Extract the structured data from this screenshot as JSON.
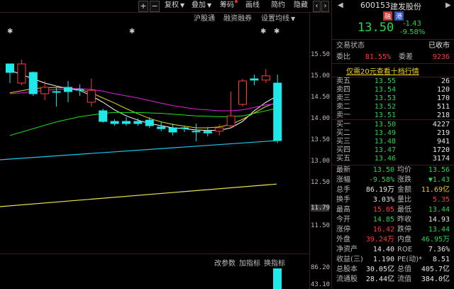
{
  "toolbar": {
    "plus": "+",
    "minus": "−",
    "restore": "复权",
    "overlay": "叠加",
    "chips": "筹码",
    "draw": "画线",
    "short": "简约",
    "hide": "隐藏",
    "prev": "‹",
    "next": "›"
  },
  "subbar": {
    "hgt": "沪股通",
    "margin": "融资融券",
    "ma_settings": "设置均线",
    "marker": "✱"
  },
  "price_axis": [
    "15.50",
    "15.00",
    "14.50",
    "14.00",
    "13.50",
    "13.00",
    "12.50",
    "11.79",
    "11.50"
  ],
  "volume_axis": [
    "86.20",
    "43.10"
  ],
  "indicator_bar": {
    "params": "改参数",
    "add": "加指标",
    "switch": "换指标"
  },
  "stock": {
    "code": "600153",
    "name": "建发股份",
    "tag1": "融",
    "tag2": "港",
    "price": "13.50",
    "change": "-1.43",
    "pct": "-9.58%"
  },
  "status": {
    "label": "交易状态",
    "value": "已收市"
  },
  "ratio": {
    "wb_label": "委比",
    "wb_value": "81.55%",
    "wc_label": "委差",
    "wc_value": "9236"
  },
  "promo": "仅需20元查看十档行情",
  "asks": [
    {
      "label": "卖五",
      "price": "13.55",
      "vol": "26"
    },
    {
      "label": "卖四",
      "price": "13.54",
      "vol": "120"
    },
    {
      "label": "卖三",
      "price": "13.53",
      "vol": "170"
    },
    {
      "label": "卖二",
      "price": "13.52",
      "vol": "511"
    },
    {
      "label": "卖一",
      "price": "13.51",
      "vol": "218"
    }
  ],
  "bids": [
    {
      "label": "买一",
      "price": "13.50",
      "vol": "4227"
    },
    {
      "label": "买二",
      "price": "13.49",
      "vol": "219"
    },
    {
      "label": "买三",
      "price": "13.48",
      "vol": "941"
    },
    {
      "label": "买四",
      "price": "13.47",
      "vol": "1720"
    },
    {
      "label": "买五",
      "price": "13.46",
      "vol": "3174"
    }
  ],
  "stats": [
    {
      "l1": "最新",
      "v1": "13.50",
      "c1": "green",
      "l2": "均价",
      "v2": "13.56",
      "c2": "green"
    },
    {
      "l1": "涨幅",
      "v1": "-9.58%",
      "c1": "green",
      "l2": "涨跌",
      "v2": "▼1.43",
      "c2": "green"
    },
    {
      "l1": "总手",
      "v1": "86.19万",
      "c1": "white",
      "l2": "金额",
      "v2": "11.69亿",
      "c2": "yellow"
    },
    {
      "l1": "换手",
      "v1": "3.03%",
      "c1": "white",
      "l2": "量比",
      "v2": "5.35",
      "c2": "red"
    },
    {
      "l1": "最高",
      "v1": "15.05",
      "c1": "red",
      "l2": "最低",
      "v2": "13.44",
      "c2": "green"
    },
    {
      "l1": "今开",
      "v1": "14.85",
      "c1": "green",
      "l2": "昨收",
      "v2": "14.93",
      "c2": "white"
    },
    {
      "l1": "涨停",
      "v1": "16.42",
      "c1": "red",
      "l2": "跌停",
      "v2": "13.44",
      "c2": "green"
    },
    {
      "l1": "外盘",
      "v1": "39.24万",
      "c1": "red",
      "l2": "内盘",
      "v2": "46.95万",
      "c2": "green"
    },
    {
      "l1": "净资产",
      "v1": "14.40",
      "c1": "white",
      "l2": "ROE",
      "v2": "7.36%",
      "c2": "white"
    },
    {
      "l1": "收益(三)",
      "v1": "1.190",
      "c1": "white",
      "l2": "PE(动)*",
      "v2": "8.51",
      "c2": "white"
    },
    {
      "l1": "总股本",
      "v1": "30.05亿",
      "c1": "white",
      "l2": "总值",
      "v2": "405.7亿",
      "c2": "white"
    },
    {
      "l1": "流通股",
      "v1": "28.44亿",
      "c1": "white",
      "l2": "流值",
      "v2": "384.0亿",
      "c2": "white"
    }
  ],
  "chart_data": {
    "type": "candlestick",
    "y_range": [
      11.4,
      15.75
    ],
    "candles": [
      {
        "o": 15.3,
        "c": 15.1,
        "h": 15.25,
        "l": 14.85
      },
      {
        "o": 14.85,
        "c": 15.3,
        "h": 15.4,
        "l": 14.8
      },
      {
        "o": 15.1,
        "c": 14.6,
        "h": 15.12,
        "l": 14.55
      },
      {
        "o": 14.6,
        "c": 14.75,
        "h": 14.9,
        "l": 14.45
      },
      {
        "o": 14.65,
        "c": 14.65,
        "h": 14.75,
        "l": 14.3
      },
      {
        "o": 14.75,
        "c": 14.65,
        "h": 14.9,
        "l": 14.4
      },
      {
        "o": 14.7,
        "c": 14.7,
        "h": 14.82,
        "l": 14.55
      },
      {
        "o": 14.4,
        "c": 14.68,
        "h": 14.95,
        "l": 14.3
      },
      {
        "o": 14.2,
        "c": 13.95,
        "h": 14.25,
        "l": 13.92
      },
      {
        "o": 13.95,
        "c": 13.9,
        "h": 14.0,
        "l": 13.85
      },
      {
        "o": 13.95,
        "c": 13.9,
        "h": 14.05,
        "l": 13.85
      },
      {
        "o": 13.95,
        "c": 13.9,
        "h": 14.02,
        "l": 13.85
      },
      {
        "o": 13.98,
        "c": 13.85,
        "h": 14.05,
        "l": 13.8
      },
      {
        "o": 13.82,
        "c": 13.78,
        "h": 13.95,
        "l": 13.72
      },
      {
        "o": 13.8,
        "c": 13.7,
        "h": 13.9,
        "l": 13.62
      },
      {
        "o": 13.8,
        "c": 13.8,
        "h": 13.85,
        "l": 13.7
      },
      {
        "o": 13.72,
        "c": 13.72,
        "h": 13.9,
        "l": 13.48
      },
      {
        "o": 13.72,
        "c": 13.68,
        "h": 13.82,
        "l": 13.6
      },
      {
        "o": 13.72,
        "c": 13.8,
        "h": 13.88,
        "l": 13.62
      },
      {
        "o": 13.85,
        "c": 14.08,
        "h": 14.65,
        "l": 13.8
      },
      {
        "o": 14.35,
        "c": 14.9,
        "h": 14.95,
        "l": 14.3
      },
      {
        "o": 14.95,
        "c": 14.92,
        "h": 15.05,
        "l": 14.8
      },
      {
        "o": 14.92,
        "c": 15.02,
        "h": 15.18,
        "l": 14.85
      },
      {
        "o": 14.85,
        "c": 13.5,
        "h": 15.05,
        "l": 13.44
      }
    ],
    "ma_lines": [
      {
        "color": "#ffffff",
        "values": [
          15.15,
          15.05,
          14.95,
          14.85,
          14.78,
          14.72,
          14.68,
          14.55,
          14.4,
          14.22,
          14.08,
          13.98,
          13.9,
          13.85,
          13.8,
          13.78,
          13.75,
          13.74,
          13.74,
          13.8,
          13.95,
          14.2,
          14.4,
          14.55
        ]
      },
      {
        "color": "#e8d020",
        "values": [
          14.62,
          14.67,
          14.72,
          14.74,
          14.75,
          14.74,
          14.7,
          14.62,
          14.5,
          14.38,
          14.25,
          14.13,
          14.02,
          13.94,
          13.88,
          13.84,
          13.8,
          13.8,
          13.82,
          13.88,
          14.0,
          14.15,
          14.3,
          14.4
        ]
      },
      {
        "color": "#e020e0",
        "values": [
          14.6,
          14.62,
          14.65,
          14.68,
          14.7,
          14.72,
          14.72,
          14.7,
          14.66,
          14.6,
          14.55,
          14.5,
          14.44,
          14.38,
          14.32,
          14.28,
          14.24,
          14.22,
          14.2,
          14.2,
          14.22,
          14.28,
          14.34,
          14.36
        ]
      },
      {
        "color": "#20e020",
        "values": [
          13.62,
          13.7,
          13.78,
          13.86,
          13.94,
          14.0,
          14.06,
          14.1,
          14.14,
          14.16,
          14.16,
          14.16,
          14.15,
          14.14,
          14.12,
          14.1,
          14.08,
          14.07,
          14.06,
          14.06,
          14.08,
          14.14,
          14.2,
          14.26
        ]
      }
    ],
    "long_lines": [
      {
        "color": "#20c8e8",
        "start": 13.05,
        "end": 13.5
      },
      {
        "color": "#e8e050",
        "start": 11.95,
        "end": 12.48
      }
    ],
    "volume": {
      "last_bar_color": "#20e8e8"
    }
  }
}
